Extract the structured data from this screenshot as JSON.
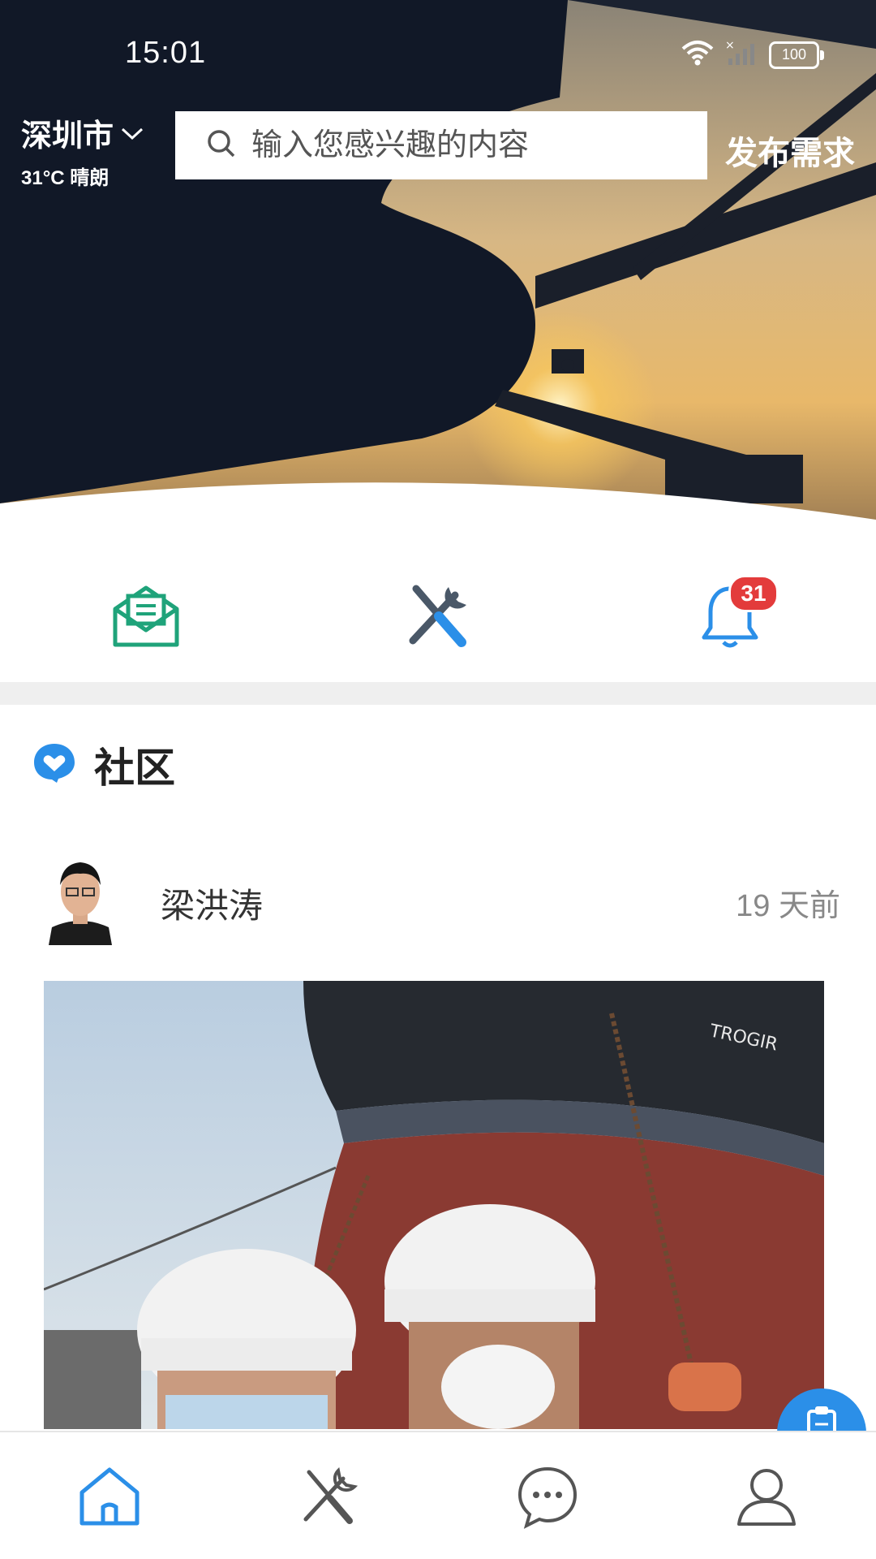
{
  "status_bar": {
    "time": "15:01",
    "battery": "100",
    "icons": [
      "wifi-icon",
      "no-signal-icon",
      "battery-icon"
    ]
  },
  "header": {
    "city": "深圳市",
    "weather": "31°C 晴朗",
    "search_placeholder": "输入您感兴趣的内容",
    "publish_label": "发布需求"
  },
  "quick_actions": [
    {
      "icon": "mail-icon",
      "color": "#1fa37a"
    },
    {
      "icon": "tools-icon",
      "color": "#3a78b8"
    },
    {
      "icon": "bell-icon",
      "color": "#2b8fe8",
      "badge": "31"
    }
  ],
  "community": {
    "title": "社区",
    "icon_color": "#2b8fe8",
    "post": {
      "author": "梁洪涛",
      "time": "19 天前"
    }
  },
  "tab_bar": [
    {
      "icon": "home-icon",
      "active": true
    },
    {
      "icon": "tools-icon",
      "active": false
    },
    {
      "icon": "chat-icon",
      "active": false
    },
    {
      "icon": "profile-icon",
      "active": false
    }
  ],
  "colors": {
    "accent": "#2b8fe8",
    "badge": "#e33b3b"
  }
}
